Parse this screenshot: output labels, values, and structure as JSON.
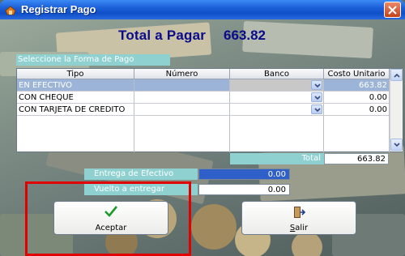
{
  "window": {
    "title": "Registrar Pago"
  },
  "header": {
    "total_label": "Total a Pagar",
    "total_value": "663.82"
  },
  "section": {
    "label": "Seleccione la Forma de Pago"
  },
  "grid": {
    "columns": [
      "Tipo",
      "Número",
      "Banco",
      "Costo Unitario"
    ],
    "rows": [
      {
        "tipo": "EN EFECTIVO",
        "numero": "",
        "banco": "",
        "costo": "663.82"
      },
      {
        "tipo": "CON CHEQUE",
        "numero": "",
        "banco": "",
        "costo": "0.00"
      },
      {
        "tipo": "CON TARJETA DE CREDITO",
        "numero": "",
        "banco": "",
        "costo": "0.00"
      }
    ]
  },
  "totals": {
    "label": "Total",
    "value": "663.82"
  },
  "payment": {
    "entrega_label": "Entrega de Efectivo",
    "entrega_value": "0.00",
    "vuelto_label": "Vuelto a entregar",
    "vuelto_value": "0.00"
  },
  "buttons": {
    "aceptar": "Aceptar",
    "salir_prefix": "S",
    "salir_rest": "alir"
  },
  "colors": {
    "accent": "#1b5fd8",
    "selection": "#9cb4d8",
    "highlight": "#e00000"
  },
  "icons": [
    "app-icon",
    "close-icon",
    "chevron-down-icon",
    "scroll-up-icon",
    "scroll-down-icon",
    "checkmark-icon",
    "exit-door-icon"
  ]
}
